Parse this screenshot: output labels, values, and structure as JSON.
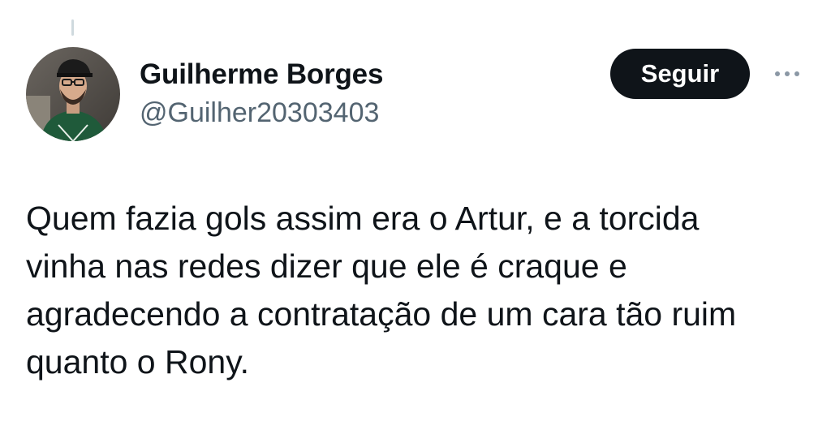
{
  "author": {
    "display_name": "Guilherme Borges",
    "handle": "@Guilher20303403"
  },
  "actions": {
    "follow_label": "Seguir",
    "more_icon": "more-horizontal-icon"
  },
  "tweet": {
    "lines": [
      "Quem fazia gols assim era o Artur, e a torcida",
      "vinha nas redes dizer que ele é craque e",
      "agradecendo a contratação de um cara tão ruim",
      "quanto o Rony."
    ]
  },
  "colors": {
    "text_primary": "#0f1419",
    "text_secondary": "#536471",
    "button_bg": "#0f1419",
    "button_text": "#ffffff",
    "thread_line": "#cfd9de"
  }
}
